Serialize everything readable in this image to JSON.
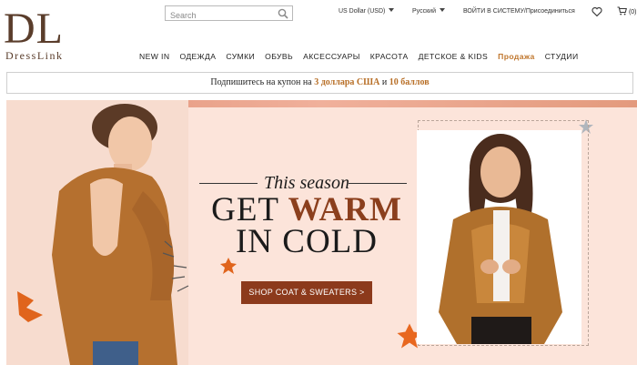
{
  "brand": {
    "mark": "DL",
    "name": "DressLink"
  },
  "search": {
    "placeholder": "Search",
    "icon": "search-icon"
  },
  "topbar": {
    "currency": "US Dollar (USD)",
    "language": "Русский",
    "login": "ВОЙТИ В СИСТЕМУ/Присоединиться",
    "cart_count": "(0)",
    "wishlist_icon": "heart-icon",
    "cart_icon": "cart-icon"
  },
  "nav": {
    "items": [
      "NEW IN",
      "ОДЕЖДА",
      "СУМКИ",
      "ОБУВЬ",
      "АКСЕССУАРЫ",
      "КРАСОТА",
      "ДЕТСКОЕ & KIDS",
      "Продажа",
      "СТУДИИ"
    ],
    "highlight_color": "#c0772e"
  },
  "coupon": {
    "prefix": "Подпишитесь на купон на ",
    "amount": "3 доллара США",
    "middle": " и ",
    "points": "10 баллов"
  },
  "banner": {
    "subtitle": "This season",
    "line1_a": "GET ",
    "line1_b": "WARM",
    "line2": "IN COLD",
    "cta": "SHOP COAT & SWEATERS >",
    "accent_color": "#8c3a1c",
    "background_color": "#fce4da"
  }
}
